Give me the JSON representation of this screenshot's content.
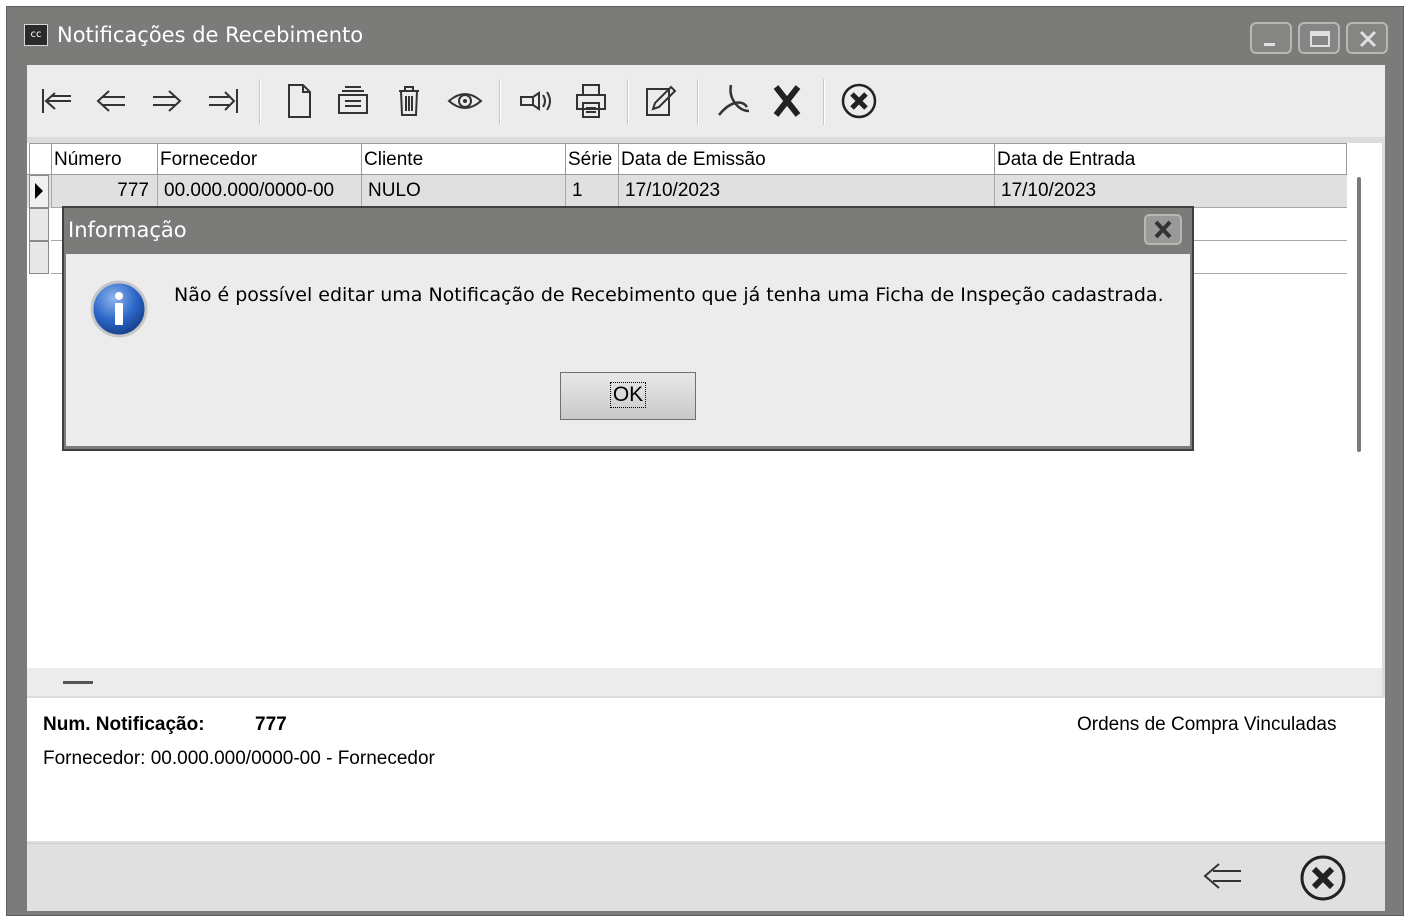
{
  "window": {
    "app_icon_text": "cc",
    "title": "Notificações de Recebimento"
  },
  "toolbar": {
    "buttons": [
      "first-record",
      "previous-record",
      "next-record",
      "last-record",
      "new-document",
      "view-list",
      "delete",
      "view",
      "announce",
      "print",
      "edit",
      "pdf",
      "excel",
      "cancel"
    ]
  },
  "grid": {
    "columns": [
      "Número",
      "Fornecedor",
      "Cliente",
      "Série",
      "Data de Emissão",
      "Data de Entrada"
    ],
    "rows": [
      {
        "numero": "777",
        "fornecedor": "00.000.000/0000-00",
        "cliente": "NULO",
        "serie": "1",
        "emissao": "17/10/2023",
        "entrada": "17/10/2023"
      }
    ]
  },
  "details": {
    "num_label": "Num. Notificação:",
    "num_value": "777",
    "fornecedor": "Fornecedor: 00.000.000/0000-00 - Fornecedor",
    "ordens": "Ordens de Compra Vinculadas"
  },
  "dialog": {
    "title": "Informação",
    "message": "Não é possível editar uma Notificação de Recebimento que já tenha uma Ficha de Inspeção cadastrada.",
    "ok_label": "OK"
  },
  "colors": {
    "titlebar": "#7b7b79",
    "info_icon": "#2a66c8"
  }
}
